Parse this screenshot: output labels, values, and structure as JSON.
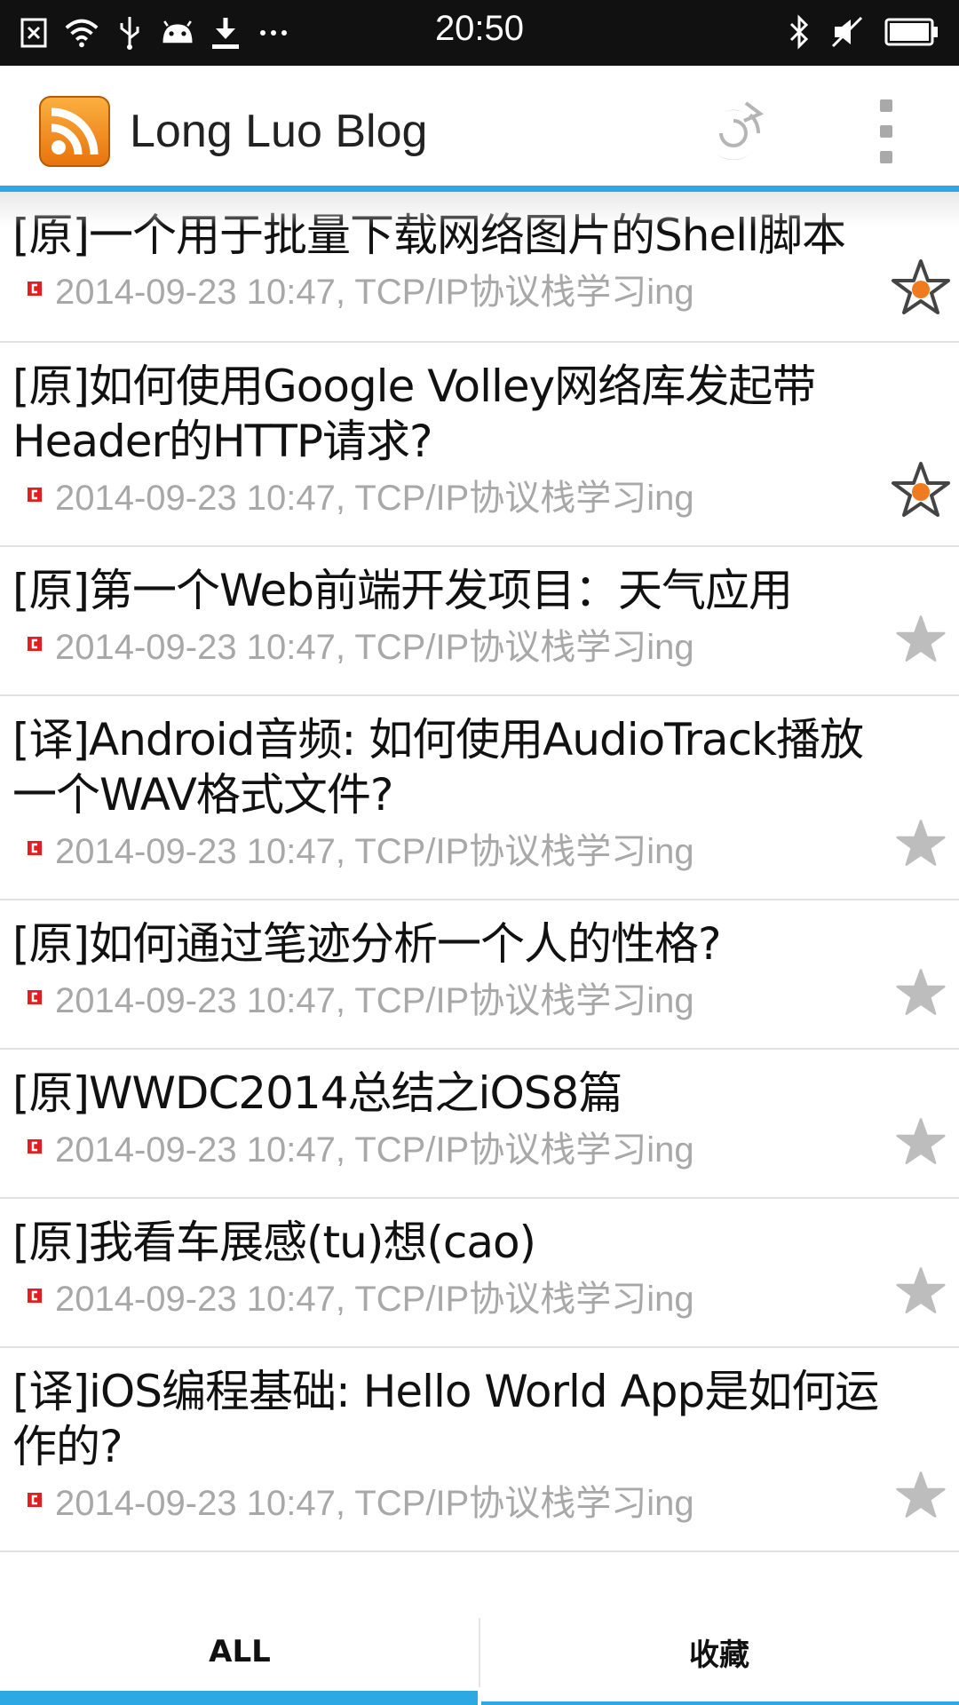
{
  "status_bar": {
    "time": "20:50",
    "left_icons": [
      "close-box-icon",
      "wifi-icon",
      "usb-icon",
      "android-icon",
      "download-icon",
      "more-dots-icon"
    ],
    "right_icons": [
      "bluetooth-icon",
      "muted-icon",
      "battery-icon"
    ]
  },
  "app_bar": {
    "title": "Long Luo Blog",
    "logo_icon": "rss-icon",
    "refresh_icon": "refresh-icon",
    "overflow_icon": "overflow-menu-icon"
  },
  "articles": [
    {
      "title": "[原]一个用于批量下载网络图片的Shell脚本",
      "meta": "2014-09-23 10:47, TCP/IP协议栈学习ing",
      "starred": true
    },
    {
      "title": "[原]如何使用Google Volley网络库发起带Header的HTTP请求?",
      "meta": "2014-09-23 10:47, TCP/IP协议栈学习ing",
      "starred": true
    },
    {
      "title": "[原]第一个Web前端开发项目：天气应用",
      "meta": "2014-09-23 10:47, TCP/IP协议栈学习ing",
      "starred": false
    },
    {
      "title": "[译]Android音频: 如何使用AudioTrack播放一个WAV格式文件?",
      "meta": "2014-09-23 10:47, TCP/IP协议栈学习ing",
      "starred": false
    },
    {
      "title": "[原]如何通过笔迹分析一个人的性格?",
      "meta": "2014-09-23 10:47, TCP/IP协议栈学习ing",
      "starred": false
    },
    {
      "title": "[原]WWDC2014总结之iOS8篇",
      "meta": "2014-09-23 10:47, TCP/IP协议栈学习ing",
      "starred": false
    },
    {
      "title": "[原]我看车展感(tu)想(cao)",
      "meta": "2014-09-23 10:47, TCP/IP协议栈学习ing",
      "starred": false
    },
    {
      "title": "[译]iOS编程基础: Hello World App是如何运作的?",
      "meta": "2014-09-23 10:47, TCP/IP协议栈学习ing",
      "starred": false
    }
  ],
  "tabs": {
    "all": "ALL",
    "favorites": "收藏",
    "selected": "all"
  },
  "colors": {
    "accent": "#2ca8e3",
    "star_active": "#f07a1e",
    "star_inactive": "#bdbdbd",
    "meta_text": "#a8a8a8",
    "source_icon": "#e02020"
  }
}
